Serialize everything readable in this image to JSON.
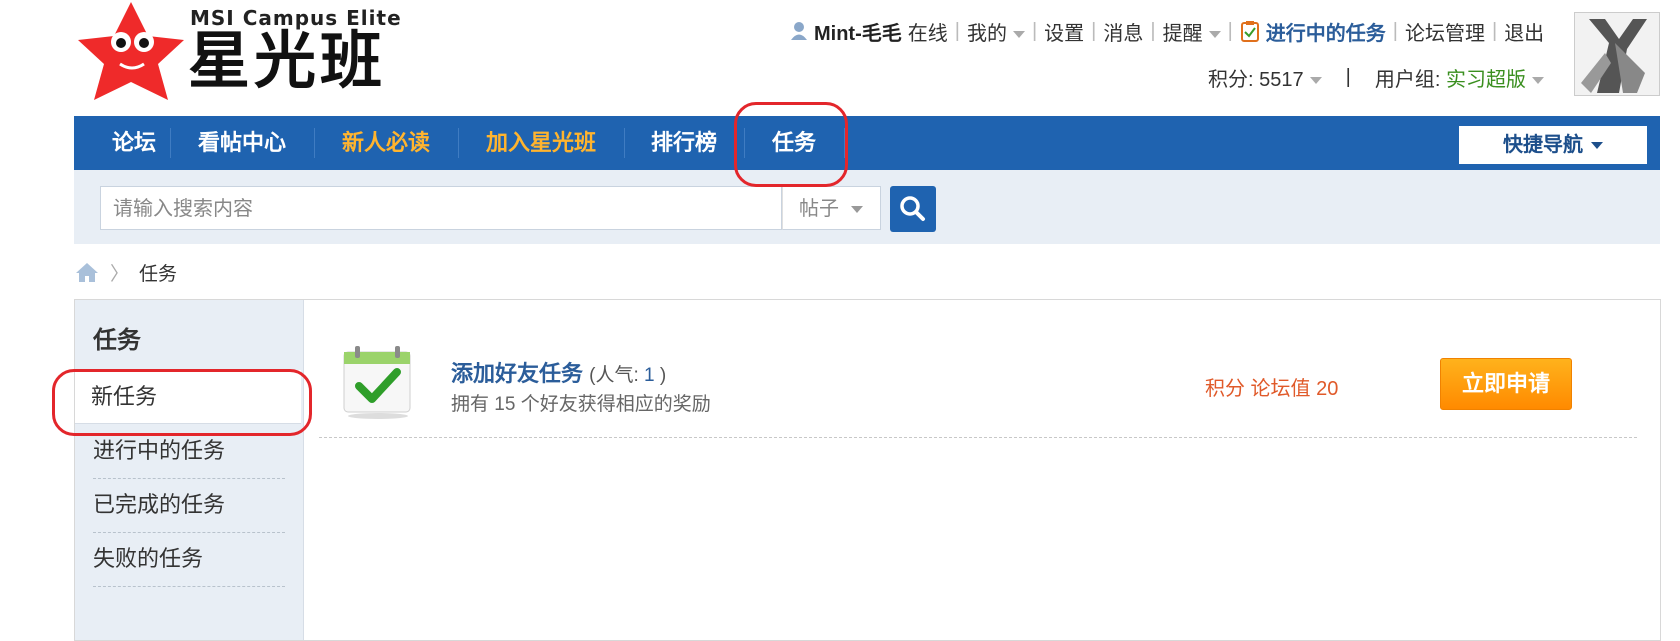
{
  "logo": {
    "en": "MSI Campus Elite",
    "cn": "星光班"
  },
  "userbar": {
    "username": "Mint-毛毛",
    "status": "在线",
    "mine": "我的",
    "settings": "设置",
    "messages": "消息",
    "reminders": "提醒",
    "ongoing_tasks": "进行中的任务",
    "forum_admin": "论坛管理",
    "logout": "退出",
    "points_label": "积分: ",
    "points_value": "5517",
    "group_label": "用户组: ",
    "group_value": "实习超版"
  },
  "nav": {
    "items": [
      "论坛",
      "看帖中心",
      "新人必读",
      "加入星光班",
      "排行榜",
      "任务"
    ],
    "quick_nav": "快捷导航"
  },
  "search": {
    "placeholder": "请输入搜索内容",
    "type": "帖子"
  },
  "breadcrumb": {
    "current": "任务"
  },
  "sidebar": {
    "title": "任务",
    "items": [
      "新任务",
      "进行中的任务",
      "已完成的任务",
      "失败的任务"
    ]
  },
  "task": {
    "title": "添加好友任务",
    "popularity_label": "(人气: ",
    "popularity_value": "1",
    "popularity_end": " )",
    "description": "拥有 15 个好友获得相应的奖励",
    "reward": "积分 论坛值 20",
    "apply_label": "立即申请"
  },
  "colors": {
    "nav_blue": "#1f63b0",
    "accent_orange": "#ffb42e",
    "button_orange": "#ff9a00",
    "reward_red": "#e05a2a",
    "annotation_red": "#e3262b"
  }
}
